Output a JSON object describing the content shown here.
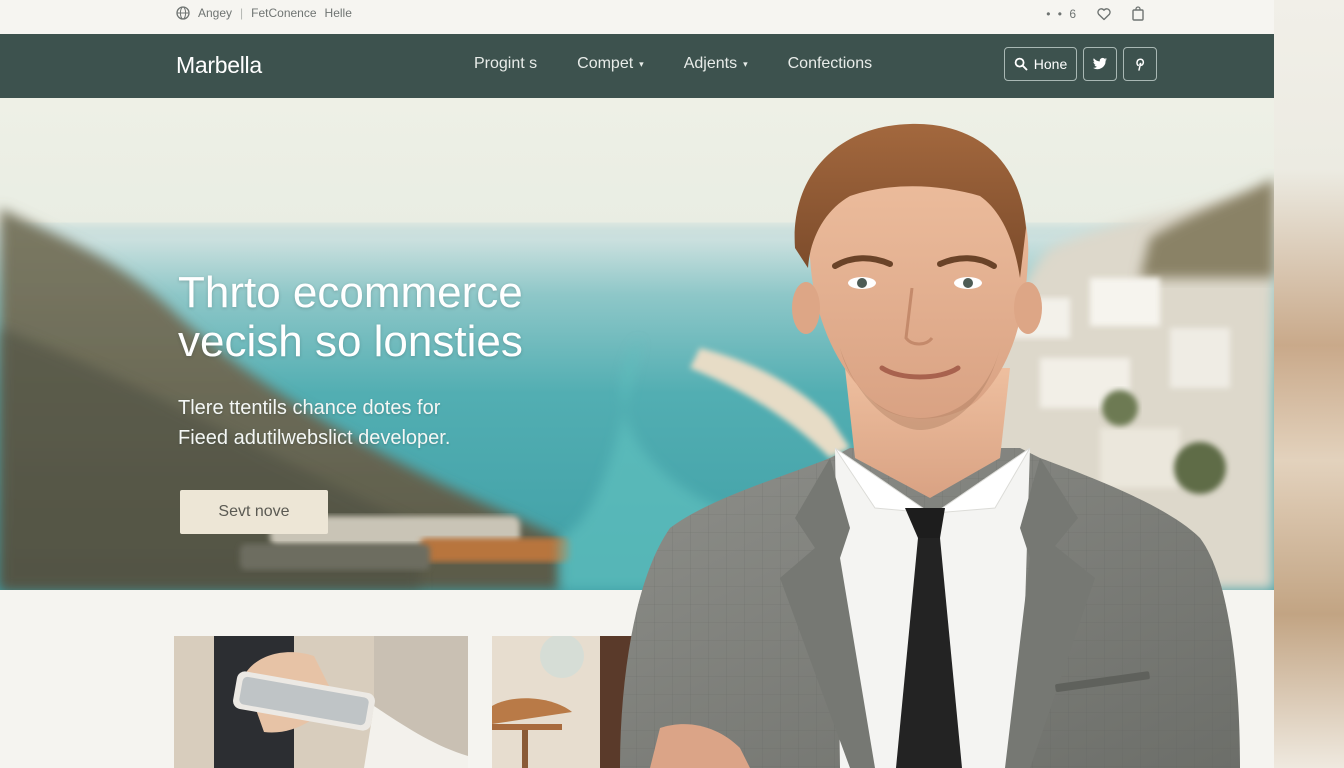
{
  "utility_bar": {
    "links": [
      "Angey",
      "FetConence",
      "Helle"
    ],
    "separator": "|",
    "right_text": "• • 6"
  },
  "navbar": {
    "brand": "Marbella",
    "links": [
      {
        "label": "Progint s",
        "has_dropdown": false
      },
      {
        "label": "Compet",
        "has_dropdown": true
      },
      {
        "label": "Adjents",
        "has_dropdown": true
      },
      {
        "label": "Confections",
        "has_dropdown": false
      }
    ],
    "caret": "▾",
    "home_button": "Hone",
    "icons": [
      "search-icon",
      "twitter-icon",
      "pinterest-icon"
    ]
  },
  "hero": {
    "title_line1": "Thrto ecommerce",
    "title_line2": "vecish so lonsties",
    "subtitle_line1": "Tlere ttentils chance dotes for",
    "subtitle_line2": "Fieed adutilwebslict developer.",
    "cta_label": "Sevt nove"
  },
  "colors": {
    "navbar": "#3d524e",
    "sea": "#4faab0",
    "cta_bg": "#ede6d6",
    "suit": "#7b7d79",
    "tie": "#1d1d1d"
  }
}
